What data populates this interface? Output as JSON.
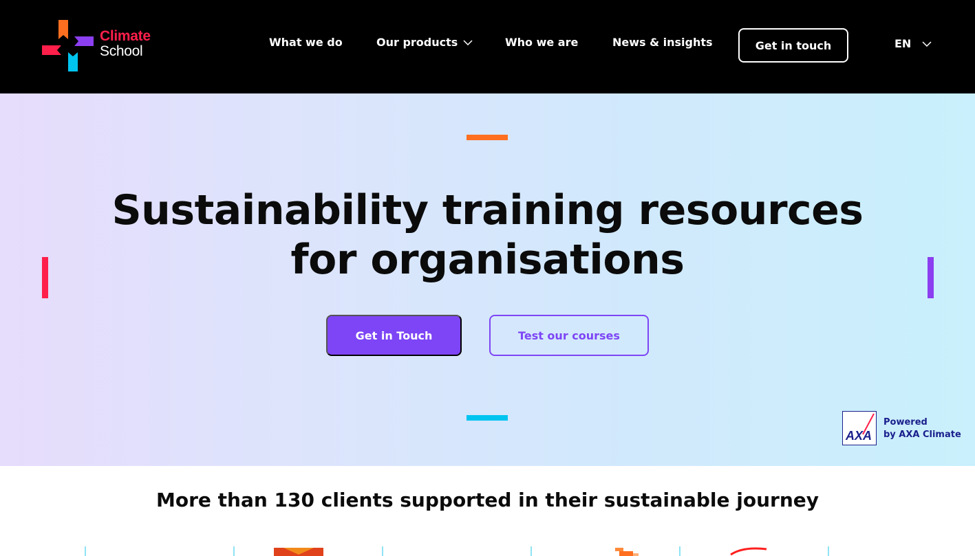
{
  "brand": {
    "name_line1": "Climate",
    "name_line2": "School",
    "colors": {
      "red": "#ff1f4b",
      "orange": "#ff6f1f",
      "purple": "#8c3ff0",
      "cyan": "#00c4f0"
    }
  },
  "nav": {
    "items": [
      {
        "label": "What we do"
      },
      {
        "label": "Our products",
        "icon": "chevron-down-icon"
      },
      {
        "label": "Who we are"
      },
      {
        "label": "News & insights"
      }
    ],
    "cta_label": "Get in touch",
    "language": {
      "label": "EN",
      "icon": "chevron-down-icon"
    }
  },
  "hero": {
    "title_line1": "Sustainability training resources",
    "title_line2": "for organisations",
    "primary_button": "Get in Touch",
    "secondary_button": "Test our courses",
    "accent_color": "#7d45f5",
    "powered_line1": "Powered",
    "powered_line2": "by AXA Climate",
    "powered_logo_text": "AXA"
  },
  "clients": {
    "title": "More than 130 clients supported in their sustainable journey"
  }
}
